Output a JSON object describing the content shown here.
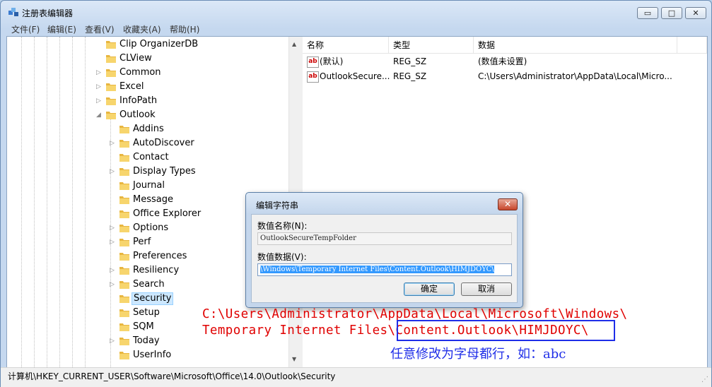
{
  "window": {
    "title": "注册表编辑器",
    "minimize": "▭",
    "maximize": "□",
    "close": "✕"
  },
  "menu": [
    "文件(F)",
    "编辑(E)",
    "查看(V)",
    "收藏夹(A)",
    "帮助(H)"
  ],
  "tree": {
    "items": [
      {
        "label": "Clip OrganizerDB",
        "depth": 0,
        "expandable": false
      },
      {
        "label": "CLView",
        "depth": 0,
        "expandable": false
      },
      {
        "label": "Common",
        "depth": 0,
        "expandable": true
      },
      {
        "label": "Excel",
        "depth": 0,
        "expandable": true
      },
      {
        "label": "InfoPath",
        "depth": 0,
        "expandable": true
      },
      {
        "label": "Outlook",
        "depth": 0,
        "expandable": true,
        "expanded": true
      },
      {
        "label": "Addins",
        "depth": 1,
        "expandable": false
      },
      {
        "label": "AutoDiscover",
        "depth": 1,
        "expandable": true
      },
      {
        "label": "Contact",
        "depth": 1,
        "expandable": false
      },
      {
        "label": "Display Types",
        "depth": 1,
        "expandable": true
      },
      {
        "label": "Journal",
        "depth": 1,
        "expandable": false
      },
      {
        "label": "Message",
        "depth": 1,
        "expandable": false
      },
      {
        "label": "Office Explorer",
        "depth": 1,
        "expandable": false
      },
      {
        "label": "Options",
        "depth": 1,
        "expandable": true
      },
      {
        "label": "Perf",
        "depth": 1,
        "expandable": true
      },
      {
        "label": "Preferences",
        "depth": 1,
        "expandable": false
      },
      {
        "label": "Resiliency",
        "depth": 1,
        "expandable": true
      },
      {
        "label": "Search",
        "depth": 1,
        "expandable": true
      },
      {
        "label": "Security",
        "depth": 1,
        "expandable": false,
        "selected": true
      },
      {
        "label": "Setup",
        "depth": 1,
        "expandable": false
      },
      {
        "label": "SQM",
        "depth": 1,
        "expandable": false
      },
      {
        "label": "Today",
        "depth": 1,
        "expandable": true
      },
      {
        "label": "UserInfo",
        "depth": 1,
        "expandable": false
      }
    ]
  },
  "list": {
    "columns": [
      "名称",
      "类型",
      "数据"
    ],
    "rows": [
      {
        "name": "(默认)",
        "type": "REG_SZ",
        "data": "(数值未设置)"
      },
      {
        "name": "OutlookSecure...",
        "type": "REG_SZ",
        "data": "C:\\Users\\Administrator\\AppData\\Local\\Micro..."
      }
    ]
  },
  "status": {
    "path": "计算机\\HKEY_CURRENT_USER\\Software\\Microsoft\\Office\\14.0\\Outlook\\Security"
  },
  "dialog": {
    "title": "编辑字符串",
    "close": "✕",
    "name_label": "数值名称(N):",
    "name_value": "OutlookSecureTempFolder",
    "data_label": "数值数据(V):",
    "data_value": "\\Windows\\Temporary Internet Files\\Content.Outlook\\HIMJDOYC\\",
    "ok": "确定",
    "cancel": "取消"
  },
  "annotation": {
    "line1": "C:\\Users\\Administrator\\AppData\\Local\\Microsoft\\Windows\\",
    "line2": "Temporary Internet Files\\Content.Outlook\\HIMJDOYC\\",
    "note": "任意修改为字母都行，如：abc",
    "colors": {
      "red": "#e00000",
      "blue": "#1f2ee8"
    }
  }
}
